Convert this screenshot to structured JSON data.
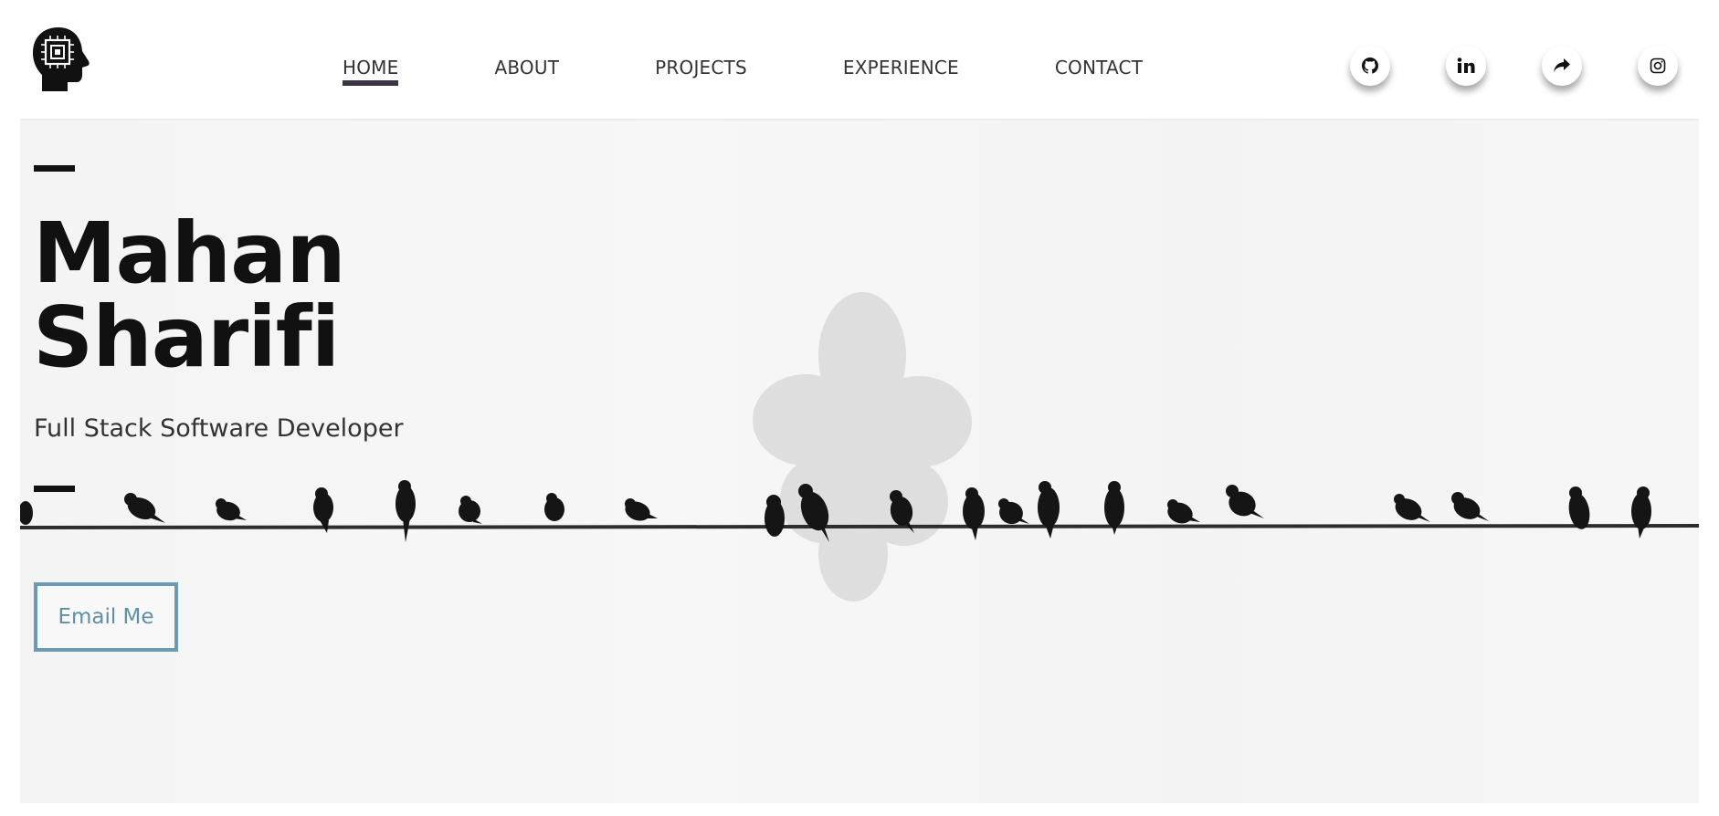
{
  "header": {
    "logo_icon": "head-with-chip-icon",
    "nav": [
      {
        "label": "HOME",
        "active": true
      },
      {
        "label": "ABOUT",
        "active": false
      },
      {
        "label": "PROJECTS",
        "active": false
      },
      {
        "label": "EXPERIENCE",
        "active": false
      },
      {
        "label": "CONTACT",
        "active": false
      }
    ],
    "socials": [
      {
        "icon": "github-icon"
      },
      {
        "icon": "linkedin-icon"
      },
      {
        "icon": "share-icon"
      },
      {
        "icon": "instagram-icon"
      }
    ]
  },
  "hero": {
    "name_line1": "Mahan",
    "name_line2": "Sharifi",
    "subtitle": "Full Stack Software Developer",
    "email_button": "Email Me",
    "background_image": "birds-on-wire-icon"
  },
  "colors": {
    "text": "#111111",
    "nav_text": "#333333",
    "nav_underline": "#3e3543",
    "button_border": "#6a9bb0",
    "button_text": "#5f8fa5"
  }
}
